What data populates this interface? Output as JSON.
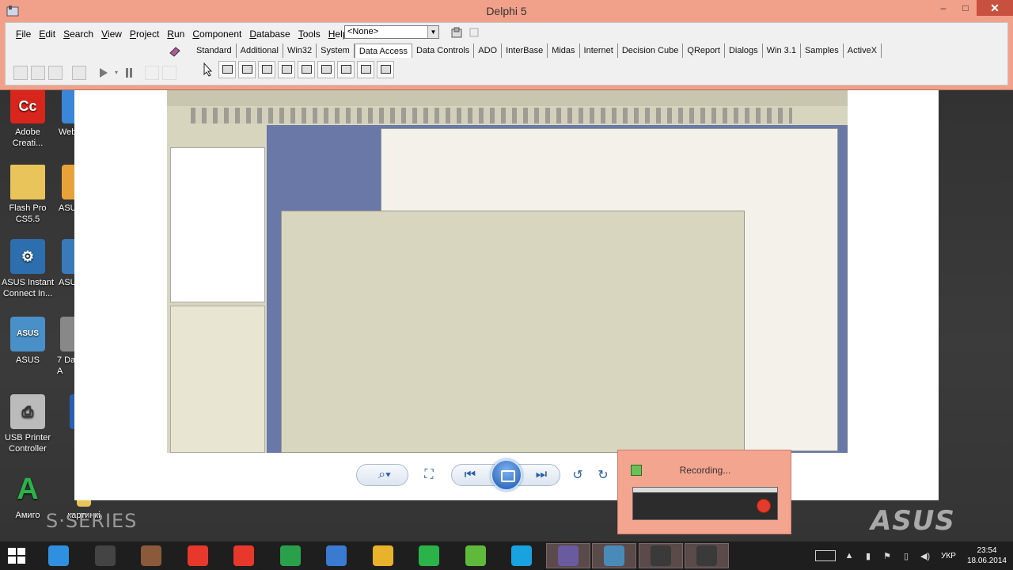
{
  "delphi": {
    "title": "Delphi 5",
    "menu": [
      {
        "pre": "",
        "ul": "F",
        "post": "ile"
      },
      {
        "pre": "",
        "ul": "E",
        "post": "dit"
      },
      {
        "pre": "",
        "ul": "S",
        "post": "earch"
      },
      {
        "pre": "",
        "ul": "V",
        "post": "iew"
      },
      {
        "pre": "",
        "ul": "P",
        "post": "roject"
      },
      {
        "pre": "",
        "ul": "R",
        "post": "un"
      },
      {
        "pre": "",
        "ul": "C",
        "post": "omponent"
      },
      {
        "pre": "",
        "ul": "D",
        "post": "atabase"
      },
      {
        "pre": "",
        "ul": "T",
        "post": "ools"
      },
      {
        "pre": "",
        "ul": "H",
        "post": "elp"
      }
    ],
    "combo_value": "<None>",
    "palette_tabs": [
      "Standard",
      "Additional",
      "Win32",
      "System",
      "Data Access",
      "Data Controls",
      "ADO",
      "InterBase",
      "Midas",
      "Internet",
      "Decision Cube",
      "QReport",
      "Dialogs",
      "Win 3.1",
      "Samples",
      "ActiveX"
    ],
    "active_tab": "Data Access",
    "components": [
      "pointer",
      "data-source",
      "table",
      "query",
      "stored-proc",
      "database",
      "session",
      "batch-move",
      "update-sql",
      "nested-table"
    ]
  },
  "desktop_icons": [
    {
      "label": "Adobe Creati...",
      "icon": "adobe-cc-icon",
      "color": "#d9261c",
      "glyph": "Cc"
    },
    {
      "label": "Flash Pro CS5.5",
      "icon": "folder-icon",
      "color": "#e8c45a",
      "glyph": ""
    },
    {
      "label": "ASUS Instant Connect In...",
      "icon": "asus-instant-connect-icon",
      "color": "#2d6fae",
      "glyph": "⚙"
    },
    {
      "label": "ASUS",
      "icon": "asus-icon",
      "color": "#4a90c8",
      "glyph": "ASUS"
    },
    {
      "label": "USB Printer Controller",
      "icon": "printer-icon",
      "color": "#bbbbbb",
      "glyph": "⎙"
    },
    {
      "label": "Амиго",
      "icon": "amigo-icon",
      "color": "#2bb34a",
      "glyph": "A"
    }
  ],
  "desktop_icons_col2": [
    {
      "label": "Web",
      "icon": "web-icon"
    },
    {
      "label": "ASU",
      "icon": "asus-shortcut-icon"
    },
    {
      "label": "ASU",
      "icon": "asus-shortcut2-icon"
    },
    {
      "label": "7 Da\n- A",
      "icon": "app-shortcut-icon"
    },
    {
      "label": "",
      "icon": "word-icon"
    },
    {
      "label": "картинкі",
      "icon": "folder-icon"
    }
  ],
  "branding": {
    "series": "S·SERIES",
    "asus": "ASUS"
  },
  "recording": {
    "title": "Recording..."
  },
  "taskbar": {
    "apps": [
      "ie-icon",
      "steam-icon",
      "game-icon",
      "yandex-icon",
      "yandex-browser-icon",
      "store-icon",
      "audio-icon",
      "chrome-icon",
      "amigo-icon",
      "utorrent-icon",
      "skype-icon",
      "delphi-icon",
      "photo-viewer-icon",
      "recorder-icon",
      "recorder-rec-icon"
    ],
    "lang": "УКР",
    "time": "23:54",
    "date": "18.06.2014"
  }
}
